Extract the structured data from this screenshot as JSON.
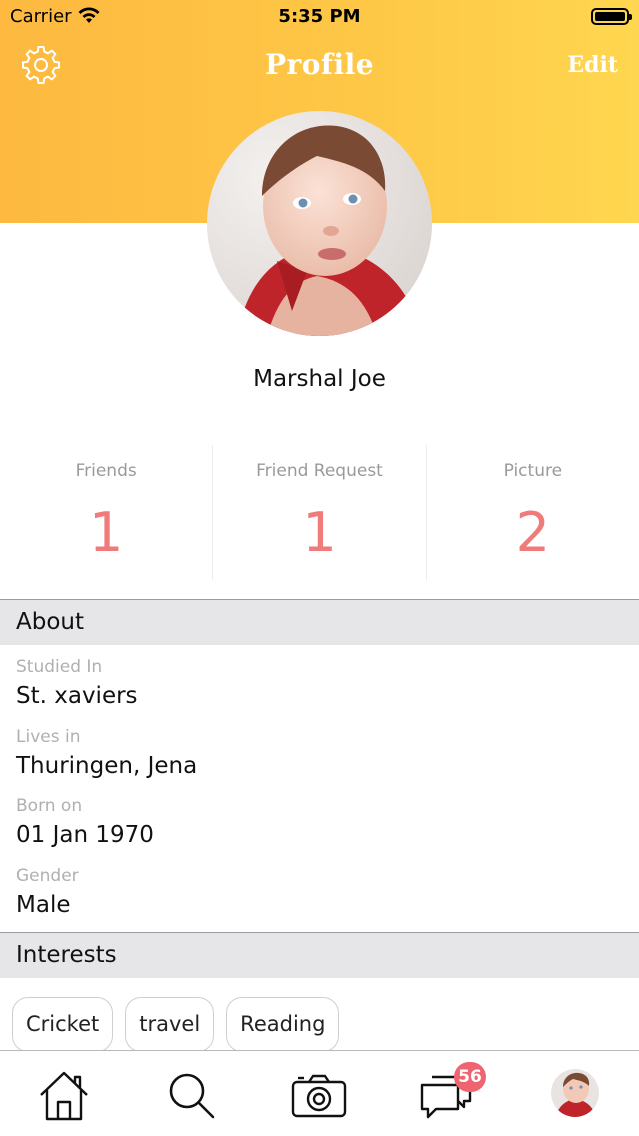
{
  "status_bar": {
    "carrier": "Carrier",
    "time": "5:35 PM"
  },
  "header": {
    "title": "Profile",
    "edit_label": "Edit",
    "settings_icon": "gear-icon",
    "gradient": [
      "#fdb940",
      "#ffd64f"
    ]
  },
  "profile": {
    "name": "Marshal Joe"
  },
  "stats": [
    {
      "label": "Friends",
      "value": "1"
    },
    {
      "label": "Friend Request",
      "value": "1"
    },
    {
      "label": "Picture",
      "value": "2"
    }
  ],
  "about": {
    "heading": "About",
    "fields": [
      {
        "label": "Studied In",
        "value": "St. xaviers"
      },
      {
        "label": "Lives in",
        "value": "Thuringen, Jena"
      },
      {
        "label": "Born on",
        "value": "01 Jan 1970"
      },
      {
        "label": "Gender",
        "value": "Male"
      }
    ]
  },
  "interests": {
    "heading": "Interests",
    "chips": [
      "Cricket",
      "travel",
      "Reading"
    ]
  },
  "tabbar": {
    "items": [
      "home-icon",
      "search-icon",
      "camera-icon",
      "chat-icon",
      "profile-avatar"
    ],
    "chat_badge": "56"
  },
  "colors": {
    "accent": "#ef7b7b",
    "badge": "#ee6470",
    "section_bg": "#e6e6e9"
  }
}
